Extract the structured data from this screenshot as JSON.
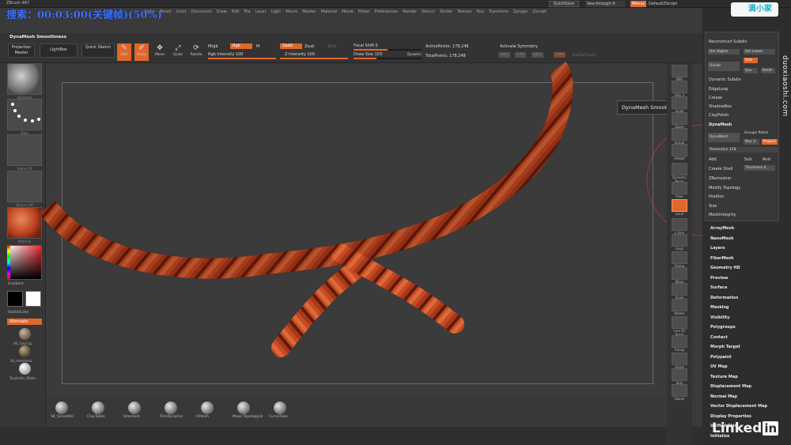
{
  "app": {
    "title": "ZBrush 4R7",
    "watermark": "搜索：00:03:00(关键帧)(50%)",
    "menu": [
      "Alpha",
      "Brush",
      "Color",
      "Document",
      "Draw",
      "Edit",
      "File",
      "Layer",
      "Light",
      "Macro",
      "Marker",
      "Material",
      "Movie",
      "Picker",
      "Preferences",
      "Render",
      "Stencil",
      "Stroke",
      "Texture",
      "Tool",
      "Transform",
      "Zplugin",
      "Zscript"
    ],
    "quicksave": "QuickSave",
    "seethrough": "See-through 0",
    "menus": "Menus",
    "defzscript": "DefaultZScript"
  },
  "toolbar": {
    "brush_title": "DynaMesh Smoothness",
    "projection_master": "Projection Master",
    "lightbox": "LightBox",
    "quick_sketch": "Quick Sketch",
    "edit": "Edit",
    "draw": "Draw",
    "move": "Move",
    "scale": "Scale",
    "rotate": "Rotate",
    "mrgb": "Mrgb",
    "rgb": "Rgb",
    "m": "M",
    "rgb_intensity": "Rgb Intensity 100",
    "zadd": "Zadd",
    "zsub": "Zsub",
    "zcut": "Zcut",
    "z_intensity": "Z Intensity 100",
    "focal_shift": "Focal Shift 0",
    "draw_size": "Draw Size 103",
    "dynamic": "Dynamic",
    "active_points": "ActivePoints: 178,248",
    "total_points": "TotalPoints: 178,248",
    "activate_symmetry": "Activate Symmetry",
    "sym_x": ">X<",
    "sym_y": ">Y<",
    "sym_z": ">Z<",
    "sym_m": ">M<",
    "radial_count": "RadialCount"
  },
  "leftshelf": {
    "thumb_captions": [
      "Standard",
      "Dots",
      "Alpha Off",
      "Texture Off",
      "Material"
    ],
    "gradient": "Gradient",
    "switch_color": "SwitchColor",
    "alternate": "Alternate",
    "materials": [
      "SK_ClayCap",
      "SK_metalness",
      "Toyplastic_Matte"
    ]
  },
  "canvas": {
    "tooltip": "DynaMesh Smoothness"
  },
  "bottom_brushes": [
    {
      "label": "SK_SmoothO"
    },
    {
      "label": "ClayTubes"
    },
    {
      "label": "Standard"
    },
    {
      "label": "TrimDynamic"
    },
    {
      "label": "hPolish"
    },
    {
      "label": "Move Topological"
    },
    {
      "label": "CurveTube"
    }
  ],
  "right_dock": [
    "BPR",
    "SPix 3",
    "Scroll",
    "Zoom",
    "Actual",
    "AAHalf",
    "Dynamic Persp",
    "Floor",
    "Local",
    "L.Sym",
    "Gxyz",
    "Frame",
    "Move",
    "Scale",
    "Rotate",
    "Line Fill PolyF",
    "Transp",
    "Ghost",
    "Solo",
    "Xpose"
  ],
  "palette": {
    "reconstruct_subdiv": "Reconstruct Subdiv",
    "del_higher": "Del Higher",
    "del_lower": "Del Lower",
    "divide": "Divide",
    "smt": "Smt",
    "suv": "Suv",
    "rel_suv": "ReUV",
    "dynamic_subdiv": "Dynamic Subdiv",
    "edgeloop": "EdgeLoop",
    "crease": "Crease",
    "shadowbox": "ShadowBox",
    "claypolish": "ClayPolish",
    "dynamesh": "DynaMesh",
    "dynamesh_btn": "DynaMesh",
    "groups_polish": "Groups Polish",
    "blur": "Blur 2",
    "project": "Project",
    "resolution": "Resolution 128",
    "add": "Add",
    "sub": "Sub",
    "and": "And",
    "create_shell": "Create Shell",
    "thickness": "Thickness 4",
    "zremesher": "ZRemesher",
    "modify_topology": "Modify Topology",
    "position": "Position",
    "size": "Size",
    "meshintegrity": "MeshIntegrity",
    "subpalettes": [
      "ArrayMesh",
      "NanoMesh",
      "Layers",
      "FiberMesh",
      "Geometry HD",
      "Preview",
      "Surface",
      "Deformation",
      "Masking",
      "Visibility",
      "Polygroups",
      "Contact",
      "Morph Target",
      "Polypaint",
      "UV Map",
      "Texture Map",
      "Displacement Map",
      "Normal Map",
      "Vector Displacement Map",
      "Display Properties",
      "Unified Skin",
      "Initialize"
    ]
  },
  "overlay": {
    "logo_text": "滴小家",
    "side_url": "duoxiaoshi.com",
    "linkedin_word": "Linked",
    "linkedin_in": "in"
  },
  "colors": {
    "accent": "#e0672a",
    "rope": "#b8401f"
  }
}
